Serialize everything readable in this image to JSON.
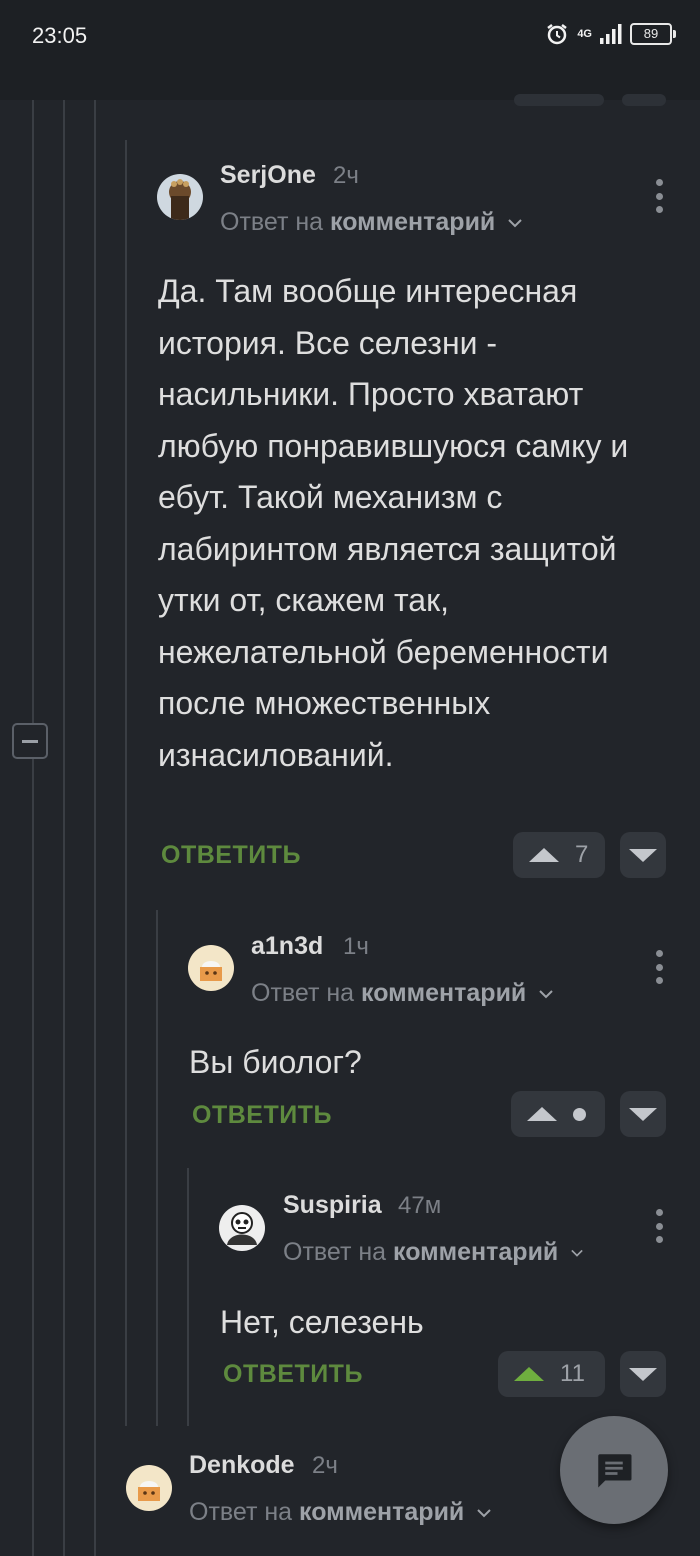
{
  "status_bar": {
    "time": "23:05",
    "network": "4G",
    "battery": "89",
    "icons": [
      "alarm-icon",
      "signal-icon",
      "battery-icon"
    ]
  },
  "comments": [
    {
      "author": "SerjOne",
      "time": "2ч",
      "reply_prefix": "Ответ на",
      "reply_target": "комментарий",
      "text": "Да. Там вообще интересная история. Все селезни - насильники. Просто хватают любую понравившуюся самку и ебут. Такой механизм с лабиринтом является защитой утки от, скажем так, нежелательной беременности после множественных изнасилований.",
      "reply_label": "ОТВЕТИТЬ",
      "rating": "7"
    },
    {
      "author": "a1n3d",
      "time": "1ч",
      "reply_prefix": "Ответ на",
      "reply_target": "комментарий",
      "text": "Вы биолог?",
      "reply_label": "ОТВЕТИТЬ",
      "rating": ""
    },
    {
      "author": "Suspiria",
      "time": "47м",
      "reply_prefix": "Ответ на",
      "reply_target": "комментарий",
      "text": "Нет, селезень",
      "reply_label": "ОТВЕТИТЬ",
      "rating": "11"
    },
    {
      "author": "Denkode",
      "time": "2ч",
      "reply_prefix": "Ответ на",
      "reply_target": "комментарий"
    }
  ],
  "colors": {
    "background": "#22252a",
    "reply_green": "#5e8a3e",
    "upvoted_green": "#6fae3f"
  }
}
